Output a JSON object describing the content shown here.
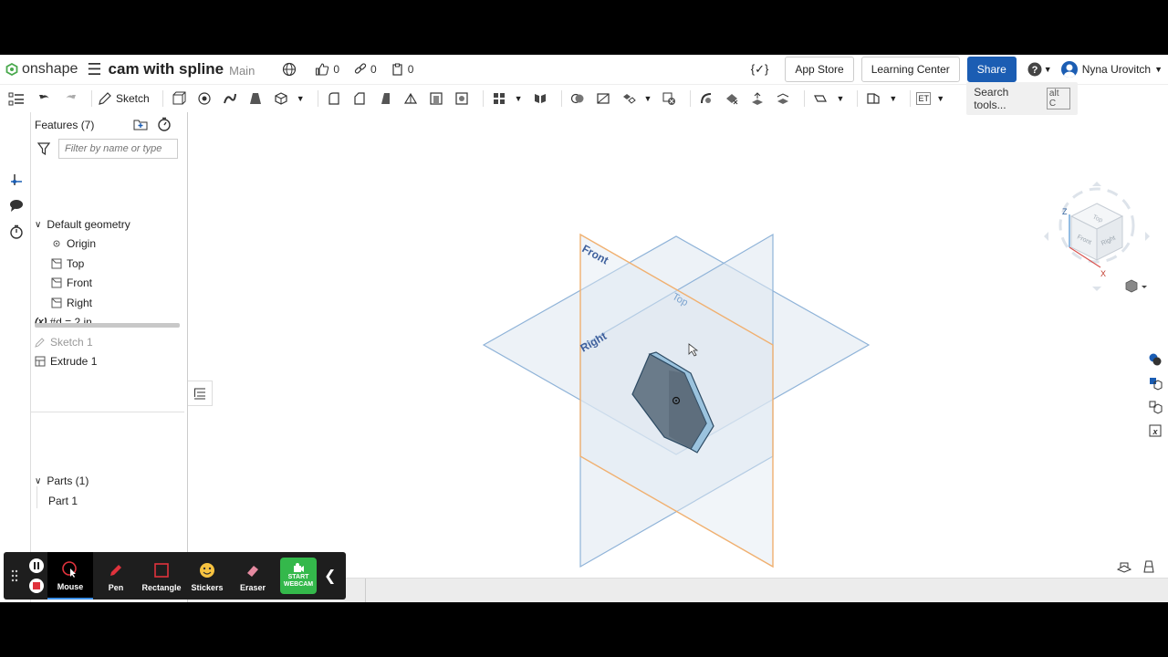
{
  "header": {
    "logo_text": "onshape",
    "document_title": "cam with spline",
    "branch": "Main",
    "likes": "0",
    "links": "0",
    "copies": "0",
    "variable_badge": "{✓}",
    "app_store": "App Store",
    "learning_center": "Learning Center",
    "share": "Share",
    "user_name": "Nyna Urovitch"
  },
  "toolbar": {
    "sketch_label": "Sketch",
    "search_label": "Search tools...",
    "search_shortcut": "alt C",
    "et_label": "ET"
  },
  "features": {
    "header": "Features (7)",
    "filter_placeholder": "Filter by name or type",
    "default_geometry": "Default geometry",
    "items": {
      "origin": "Origin",
      "top": "Top",
      "front": "Front",
      "right": "Right",
      "variable": "#d = 2 in",
      "sketch": "Sketch 1",
      "extrude": "Extrude 1"
    },
    "variable_icon": "(x)"
  },
  "parts": {
    "header": "Parts (1)",
    "items": [
      "Part 1"
    ]
  },
  "viewport": {
    "plane_front": "Front",
    "plane_top": "Top",
    "plane_right": "Right",
    "cube_top": "Top",
    "cube_front": "Front",
    "cube_right": "Right",
    "axis_z": "Z",
    "axis_x": "X",
    "colors": {
      "front_plane_edge": "#f0b070",
      "plane_edge": "#8fb3d8",
      "plane_fill": "#dfe8f1",
      "part_face": "#6a7b8a",
      "part_side": "#9bc3de"
    }
  },
  "recorder": {
    "tools": [
      "Mouse",
      "Pen",
      "Rectangle",
      "Stickers",
      "Eraser"
    ],
    "webcam_line1": "START",
    "webcam_line2": "WEBCAM"
  }
}
